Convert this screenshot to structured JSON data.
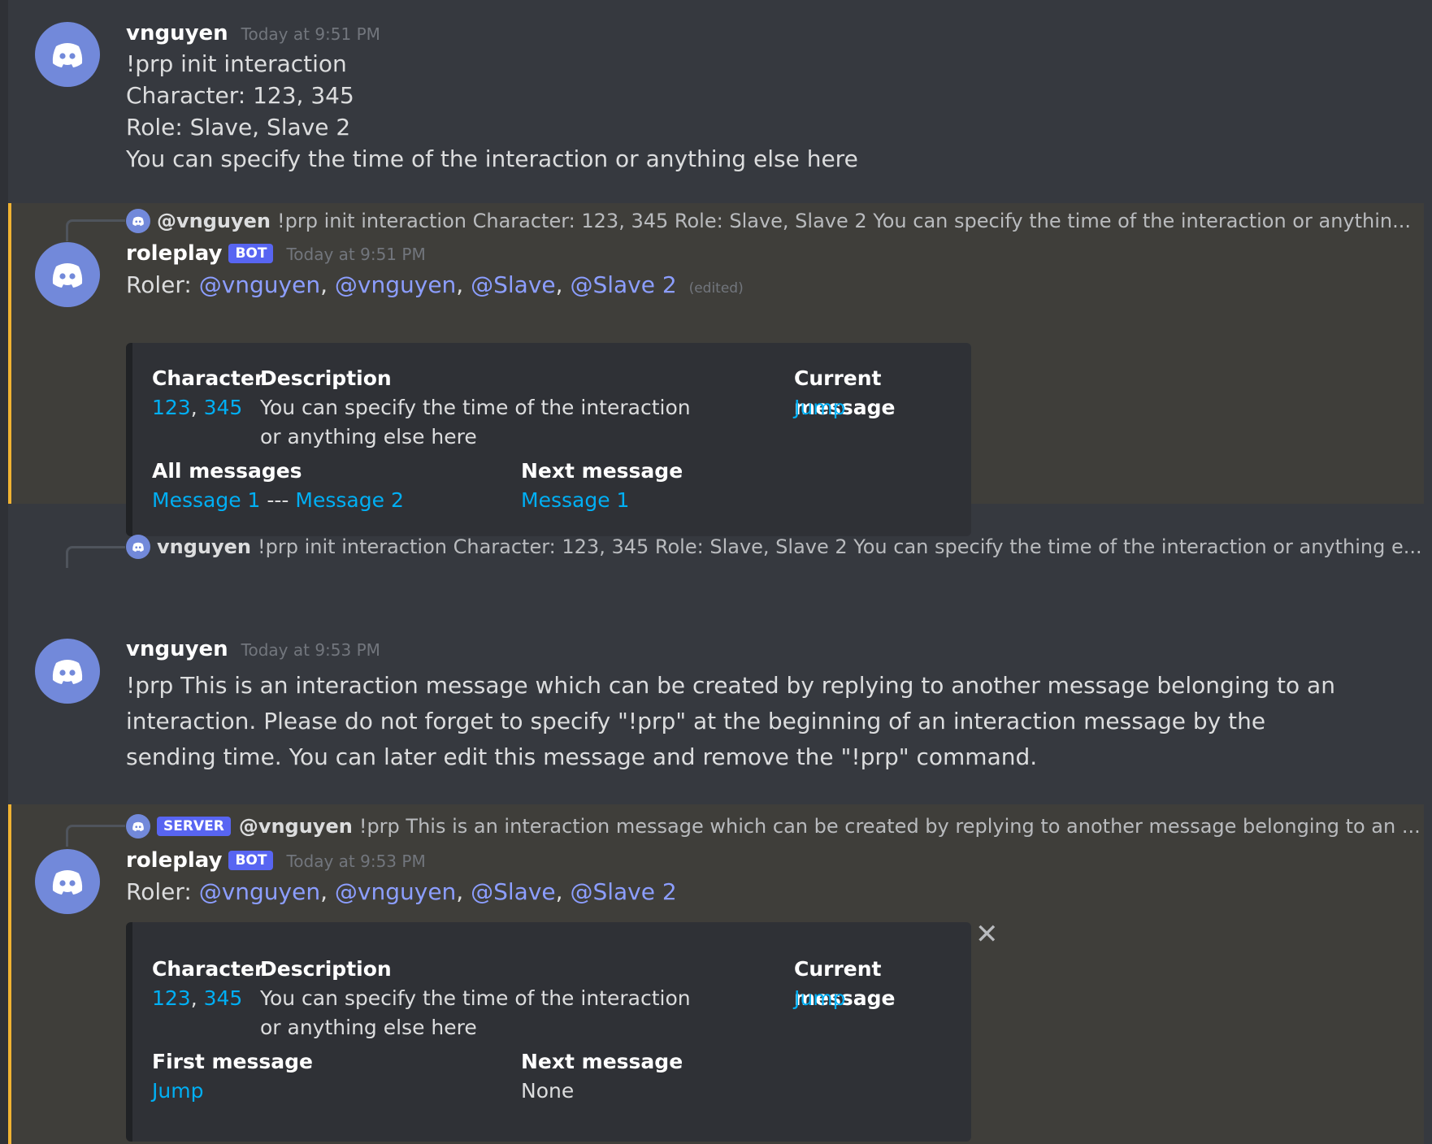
{
  "messages": [
    {
      "author": "vnguyen",
      "timestamp": "Today at 9:51 PM",
      "lines": [
        "!prp init interaction",
        "Character: 123, 345",
        "Role: Slave, Slave 2",
        "You can specify the time of the interaction or anything else here"
      ]
    },
    {
      "reply": {
        "author": "@vnguyen",
        "preview": "!prp init interaction Character: 123, 345 Role: Slave, Slave 2 You can specify the time of the interaction or anythin..."
      },
      "author": "roleplay",
      "bot_tag": "BOT",
      "timestamp": "Today at 9:51 PM",
      "roler_label": "Roler:",
      "mentions": [
        "@vnguyen",
        "@vnguyen",
        "@Slave",
        "@Slave 2"
      ],
      "separator": ",",
      "edited": "(edited)",
      "embed": {
        "character_title": "Character",
        "character_values": [
          "123",
          "345"
        ],
        "description_title": "Description",
        "description": "You can specify the time of the interaction or anything else here",
        "current_title": "Current message",
        "current_link": "Jump",
        "all_title": "All messages",
        "all_links": [
          "Message 1",
          "Message 2"
        ],
        "all_sep": "---",
        "next_title": "Next message",
        "next_link": "Message 1"
      }
    },
    {
      "reply": {
        "author": "vnguyen",
        "preview": "!prp init interaction Character: 123, 345 Role: Slave, Slave 2 You can specify the time of the interaction or anything e..."
      },
      "author": "vnguyen",
      "timestamp": "Today at 9:53 PM",
      "body": "!prp This is an interaction message which can be created by replying to another message belonging to an interaction. Please do not forget to specify \"!prp\" at the beginning of an interaction message by the sending time. You can later edit this message and remove the \"!prp\" command."
    },
    {
      "reply": {
        "server_tag": "SERVER",
        "author": "@vnguyen",
        "preview": "!prp This is an interaction message which can be created by replying to another message belonging to an ..."
      },
      "author": "roleplay",
      "bot_tag": "BOT",
      "timestamp": "Today at 9:53 PM",
      "roler_label": "Roler:",
      "mentions": [
        "@vnguyen",
        "@vnguyen",
        "@Slave",
        "@Slave 2"
      ],
      "separator": ",",
      "embed": {
        "character_title": "Character",
        "character_values": [
          "123",
          "345"
        ],
        "description_title": "Description",
        "description": "You can specify the time of the interaction or anything else here",
        "current_title": "Current message",
        "current_link": "Jump",
        "first_title": "First message",
        "first_link": "Jump",
        "next_title": "Next message",
        "next_value": "None"
      },
      "close_symbol": "✕"
    }
  ],
  "colors": {
    "accent": "#7289da",
    "link": "#00aff4",
    "mention": "#8c9eff",
    "highlight_bar": "#f0b232"
  }
}
